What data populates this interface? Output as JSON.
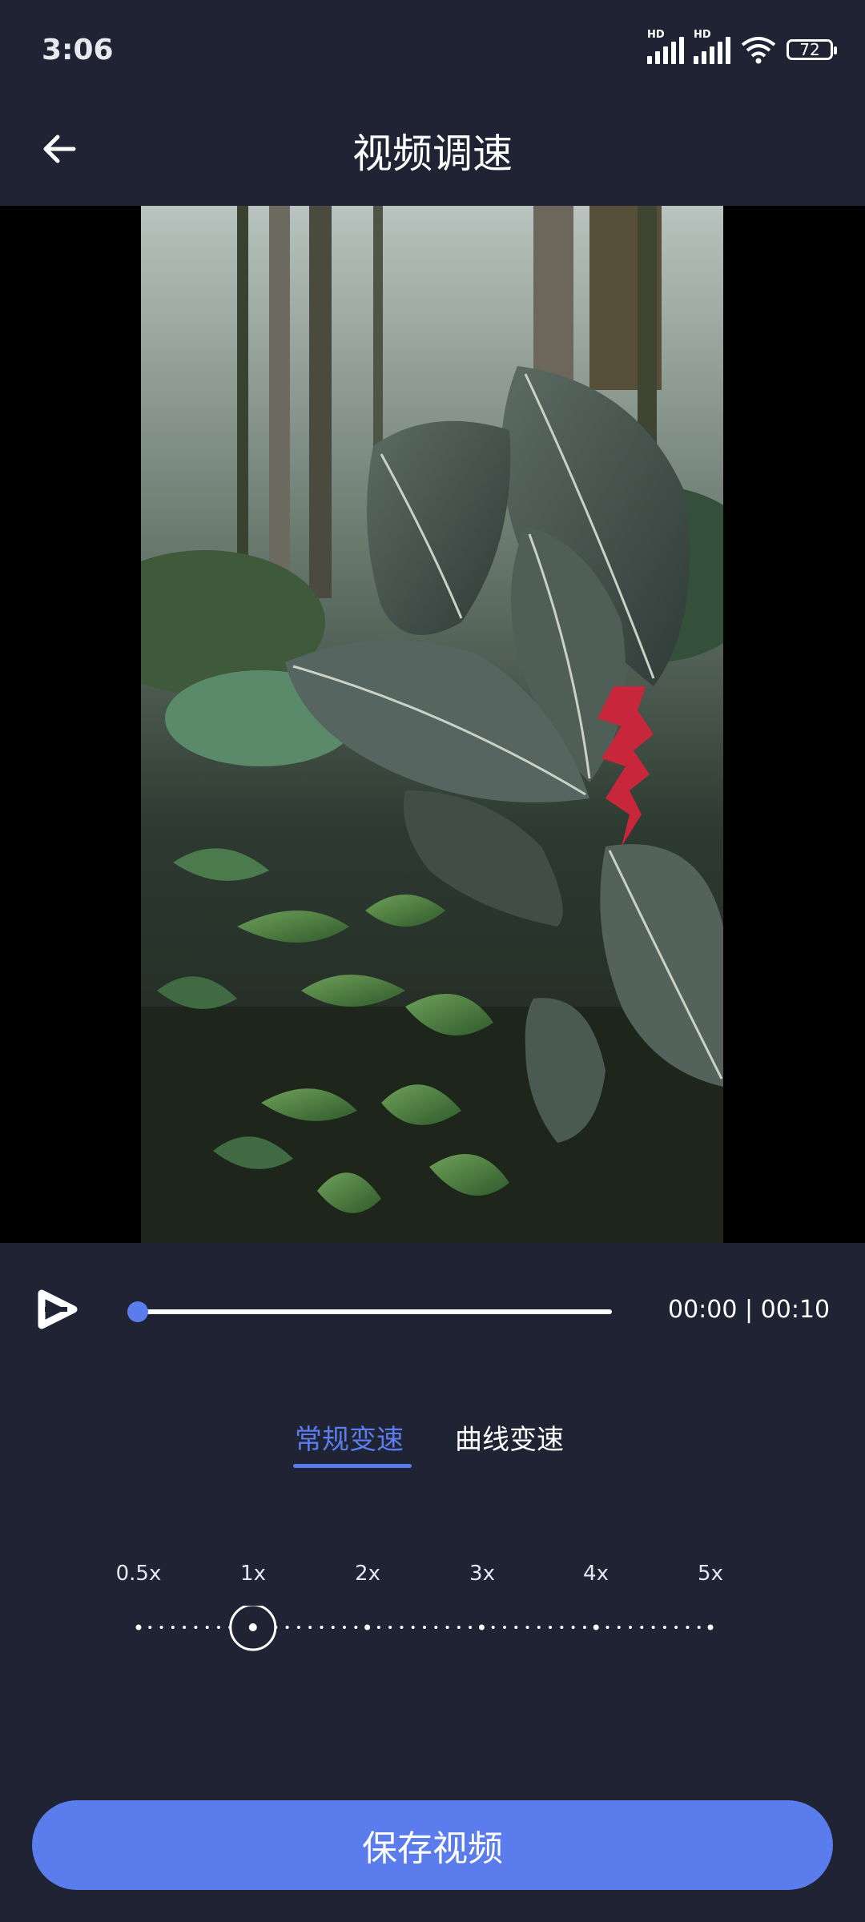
{
  "status": {
    "time": "3:06",
    "battery": "72",
    "network_label": "HD"
  },
  "header": {
    "title": "视频调速",
    "back_icon": "arrow-left-icon"
  },
  "player": {
    "current_time": "00:00",
    "total_time": "00:10",
    "progress_fraction": 0.0,
    "play_icon": "play-icon"
  },
  "tabs": [
    {
      "label": "常规变速",
      "active": true
    },
    {
      "label": "曲线变速",
      "active": false
    }
  ],
  "speed": {
    "options": [
      "0.5x",
      "1x",
      "2x",
      "3x",
      "4x",
      "5x"
    ],
    "selected": "1x"
  },
  "save_button": {
    "label": "保存视频"
  },
  "colors": {
    "background": "#1f2334",
    "accent": "#5b7ced"
  }
}
